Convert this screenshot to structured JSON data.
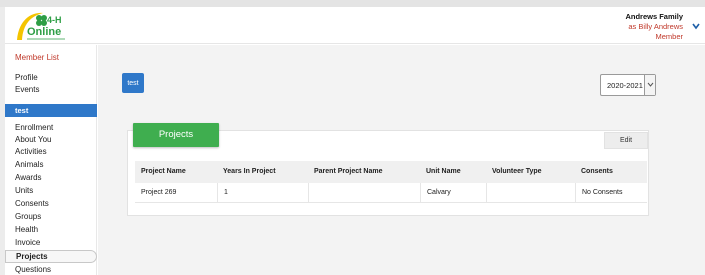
{
  "header": {
    "logo_text": "4-H Online",
    "user_family": "Andrews Family",
    "user_as": "as Billy Andrews",
    "user_role": "Member"
  },
  "sidebar": {
    "member_list": "Member List",
    "profile": "Profile",
    "events": "Events",
    "active_member": "test",
    "items": [
      "Enrollment",
      "About You",
      "Activities",
      "Animals",
      "Awards",
      "Units",
      "Consents",
      "Groups",
      "Health",
      "Invoice"
    ],
    "selected": "Projects",
    "after": "Questions"
  },
  "main": {
    "member_tag": "test",
    "year_value": "2020-2021",
    "projects_title": "Projects",
    "edit_label": "Edit",
    "table": {
      "headers": [
        "Project Name",
        "Years In Project",
        "Parent Project Name",
        "Unit Name",
        "Volunteer Type",
        "Consents"
      ],
      "rows": [
        [
          "Project 269",
          "1",
          "",
          "Calvary",
          "",
          "No Consents"
        ]
      ]
    }
  },
  "colors": {
    "accent_blue": "#2f78c9",
    "project_green": "#3fae4f",
    "alert_red": "#c0392b"
  }
}
